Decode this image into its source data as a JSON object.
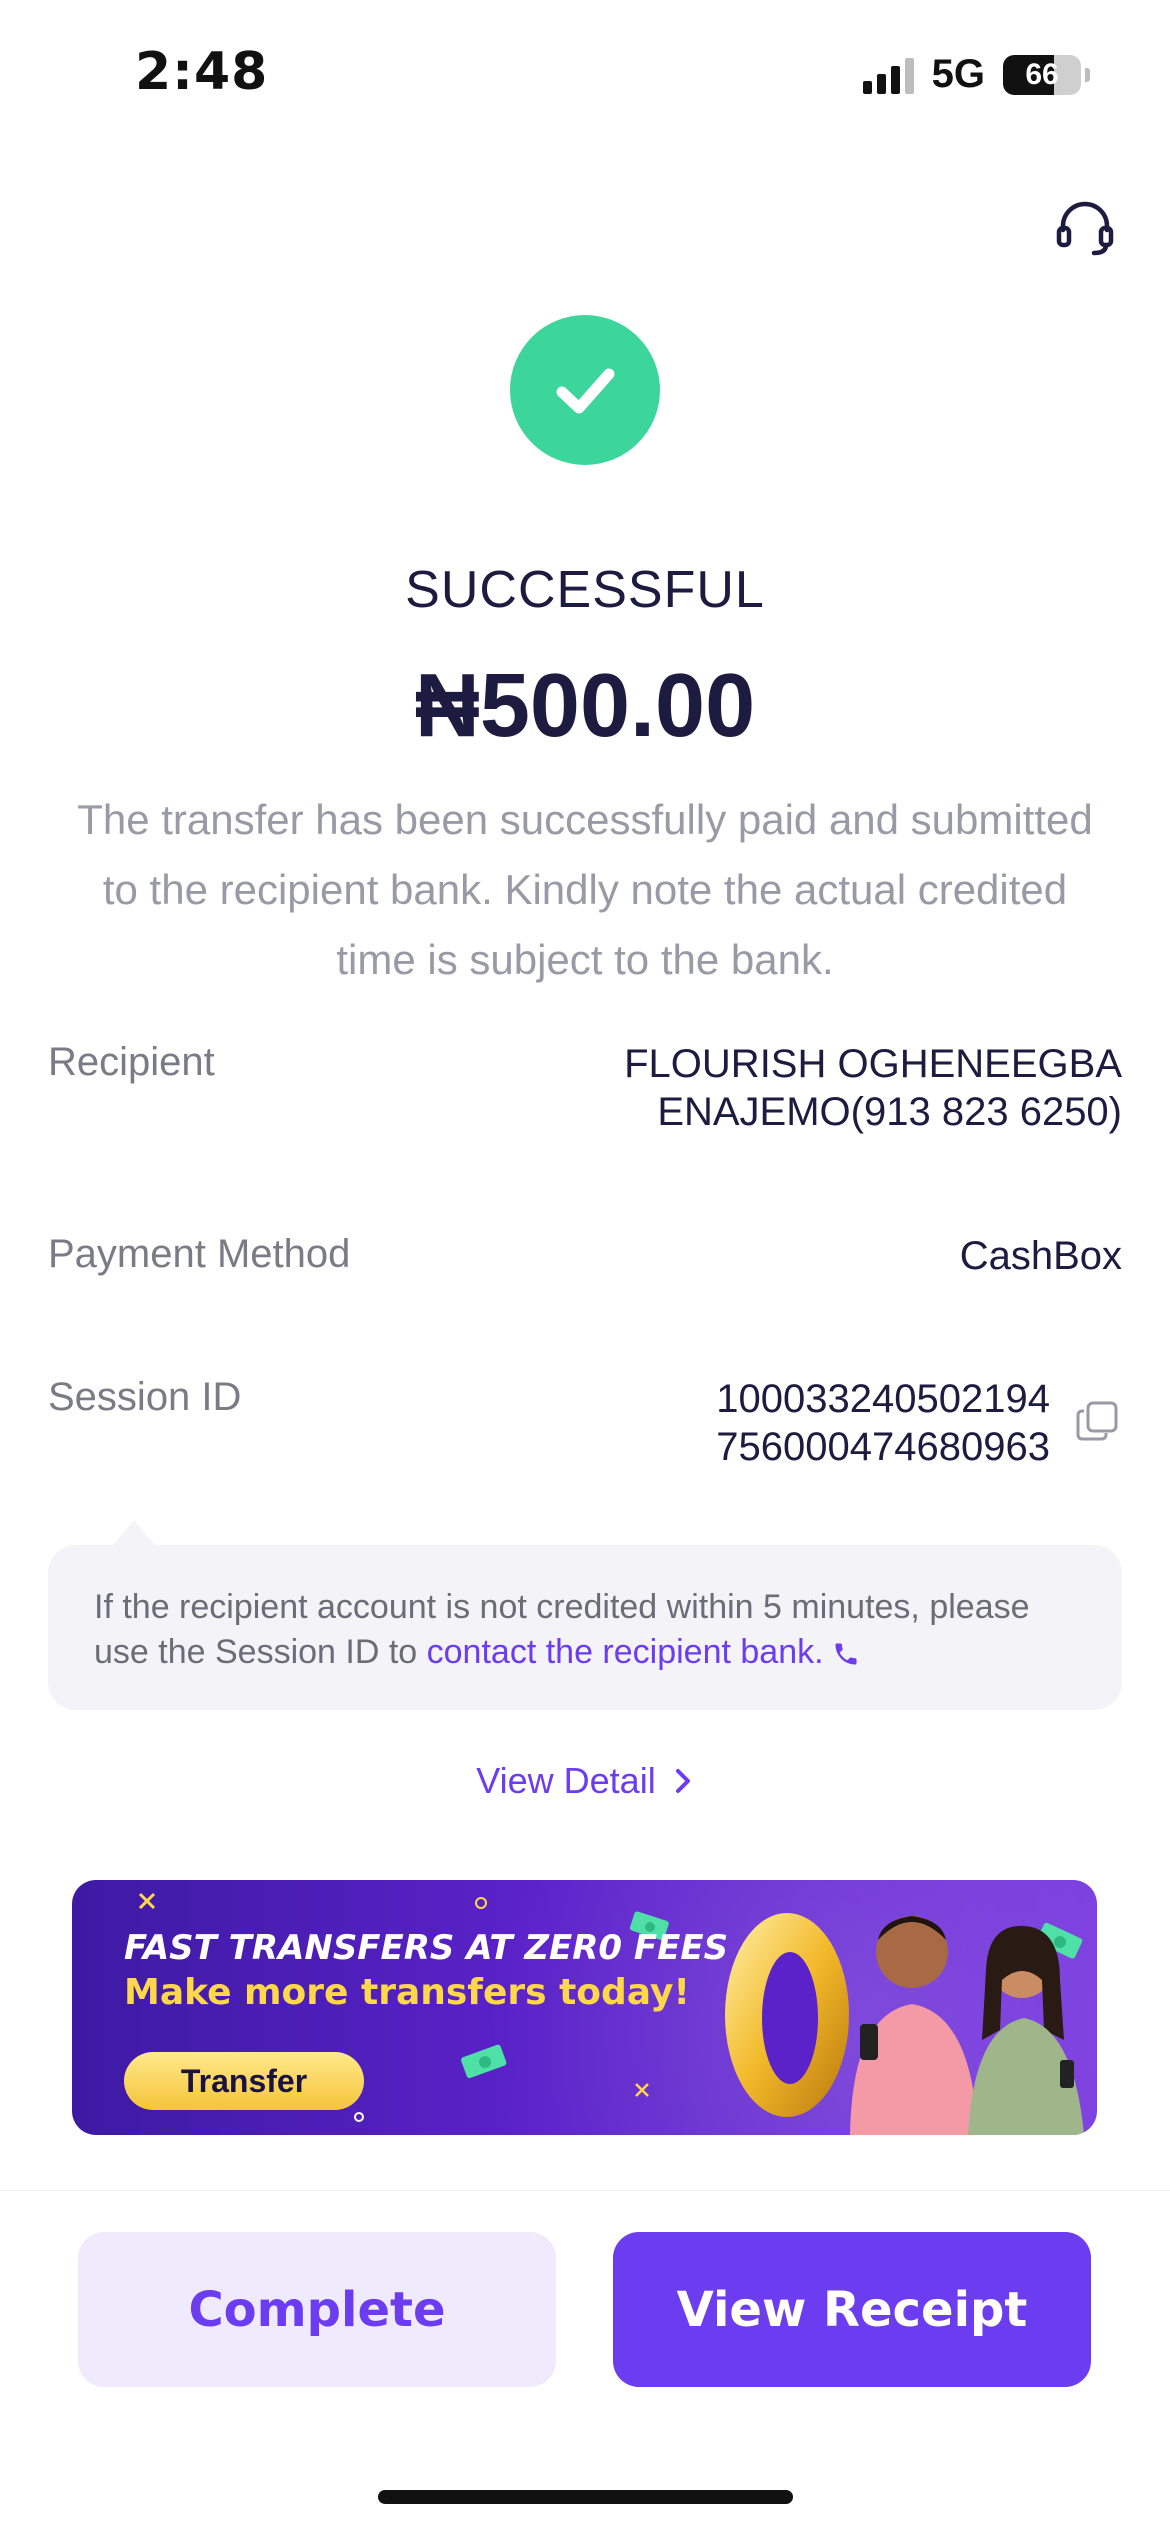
{
  "status_bar": {
    "time": "2:48",
    "network": "5G",
    "battery": "66",
    "battery_level": 0.66
  },
  "header": {
    "support_icon": "headset-icon"
  },
  "result": {
    "status": "SUCCESSFUL",
    "amount": "₦500.00",
    "description": "The transfer has been successfully paid and submitted to the recipient bank. Kindly note the actual credited time is subject to the bank."
  },
  "details": {
    "recipient_label": "Recipient",
    "recipient_value_line1": "FLOURISH OGHENEEGBA",
    "recipient_value_line2": "ENAJEMO(913 823 6250)",
    "method_label": "Payment Method",
    "method_value": "CashBox",
    "session_label": "Session ID",
    "session_value_line1": "100033240502194",
    "session_value_line2": "756000474680963"
  },
  "notice": {
    "text": "If the recipient account is not credited within 5 minutes, please use the Session ID to ",
    "link": "contact the recipient bank."
  },
  "view_detail": "View Detail",
  "banner": {
    "line1": "FAST TRANSFERS AT ZER0 FEES",
    "line2": "Make more transfers today!",
    "button": "Transfer"
  },
  "actions": {
    "complete": "Complete",
    "view_receipt": "View Receipt"
  },
  "colors": {
    "accent": "#6c3cf0",
    "success": "#3cd59b",
    "text_dark": "#1d1b3f"
  }
}
